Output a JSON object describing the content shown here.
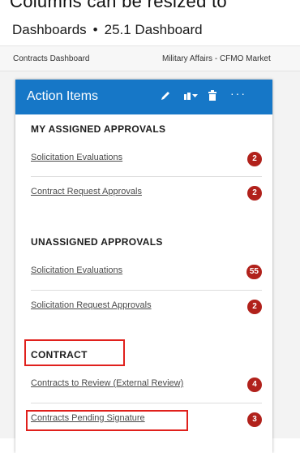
{
  "caption": "Columns can be resized to",
  "breadcrumb": {
    "root": "Dashboards",
    "separator": "•",
    "current": "25.1 Dashboard"
  },
  "tabs": [
    "Contracts Dashboard",
    "Military Affairs - CFMO Market"
  ],
  "card": {
    "title": "Action Items",
    "icons": [
      "edit-icon",
      "sort-icon",
      "delete-icon",
      "more-icon"
    ],
    "more_glyph": "···",
    "sections": [
      {
        "heading": "MY ASSIGNED APPROVALS",
        "rows": [
          {
            "label": "Solicitation Evaluations",
            "count": "2"
          },
          {
            "label": "Contract Request Approvals",
            "count": "2"
          }
        ]
      },
      {
        "heading": "UNASSIGNED APPROVALS",
        "rows": [
          {
            "label": "Solicitation Evaluations",
            "count": "55"
          },
          {
            "label": "Solicitation Request Approvals",
            "count": "2"
          }
        ]
      },
      {
        "heading": "CONTRACT",
        "rows": [
          {
            "label": "Contracts to Review (External Review)",
            "count": "4"
          },
          {
            "label": "Contracts Pending Signature",
            "count": "3"
          }
        ]
      }
    ]
  },
  "colors": {
    "header_blue": "#1677c7",
    "badge_red": "#b1211b",
    "highlight_red": "#e0201c"
  }
}
